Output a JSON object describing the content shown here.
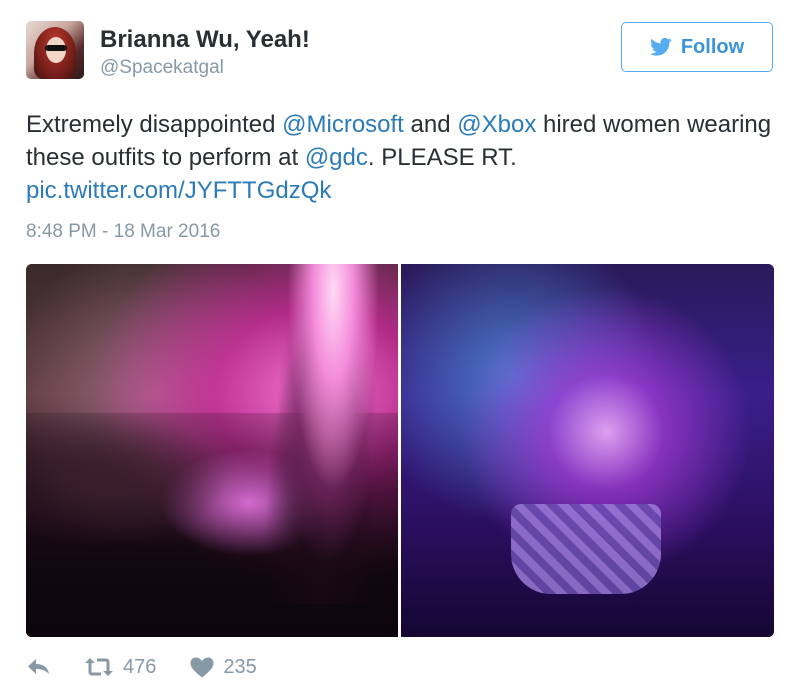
{
  "user": {
    "name": "Brianna Wu, Yeah!",
    "handle": "@Spacekatgal",
    "avatar_icon": "avatar-photo"
  },
  "follow_button": {
    "label": "Follow",
    "icon": "twitter-bird-icon",
    "color": "#3b94d9",
    "border_color": "#55acee"
  },
  "tweet": {
    "text_parts": [
      "Extremely disappointed ",
      "@Microsoft",
      " and ",
      "@Xbox",
      " hired women wearing these outfits to perform at ",
      "@gdc",
      ". PLEASE RT. ",
      "pic.twitter.com/JYFTTGdzQk"
    ],
    "link_color": "#2b7bb9",
    "timestamp": "8:48 PM - 18 Mar 2016"
  },
  "media": {
    "photos": [
      "photo-left",
      "photo-right"
    ]
  },
  "actions": {
    "reply_icon": "reply-icon",
    "retweet_icon": "retweet-icon",
    "retweet_count": "476",
    "like_icon": "heart-icon",
    "like_count": "235",
    "icon_color": "#8899a6"
  }
}
